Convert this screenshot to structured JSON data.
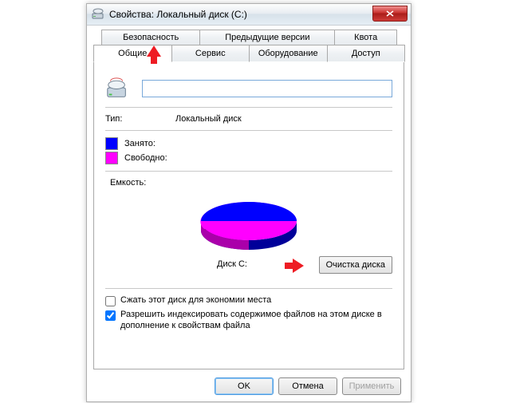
{
  "window": {
    "title": "Свойства: Локальный диск (C:)"
  },
  "tabs_back": [
    {
      "label": "Безопасность"
    },
    {
      "label": "Предыдущие версии"
    },
    {
      "label": "Квота"
    }
  ],
  "tabs_front": [
    {
      "label": "Общие"
    },
    {
      "label": "Сервис"
    },
    {
      "label": "Оборудование"
    },
    {
      "label": "Доступ"
    }
  ],
  "general": {
    "name_value": "",
    "type_label": "Тип:",
    "type_value": "Локальный диск",
    "used_label": "Занято:",
    "free_label": "Свободно:",
    "capacity_label": "Емкость:",
    "disk_label": "Диск C:",
    "cleanup_button": "Очистка диска",
    "compress_label": "Сжать этот диск для экономии места",
    "index_label": "Разрешить индексировать содержимое файлов на этом диске в дополнение к свойствам файла",
    "compress_checked": false,
    "index_checked": true
  },
  "colors": {
    "used": "#0000FF",
    "free": "#FF00FF"
  },
  "chart_data": {
    "type": "pie",
    "title": "",
    "series": [
      {
        "name": "Занято",
        "value": 55,
        "color": "#0000FF"
      },
      {
        "name": "Свободно",
        "value": 45,
        "color": "#FF00FF"
      }
    ],
    "note": "values are approximate percentages estimated from the chart; exact byte values are not visible in the screenshot"
  },
  "buttons": {
    "ok": "OK",
    "cancel": "Отмена",
    "apply": "Применить"
  }
}
